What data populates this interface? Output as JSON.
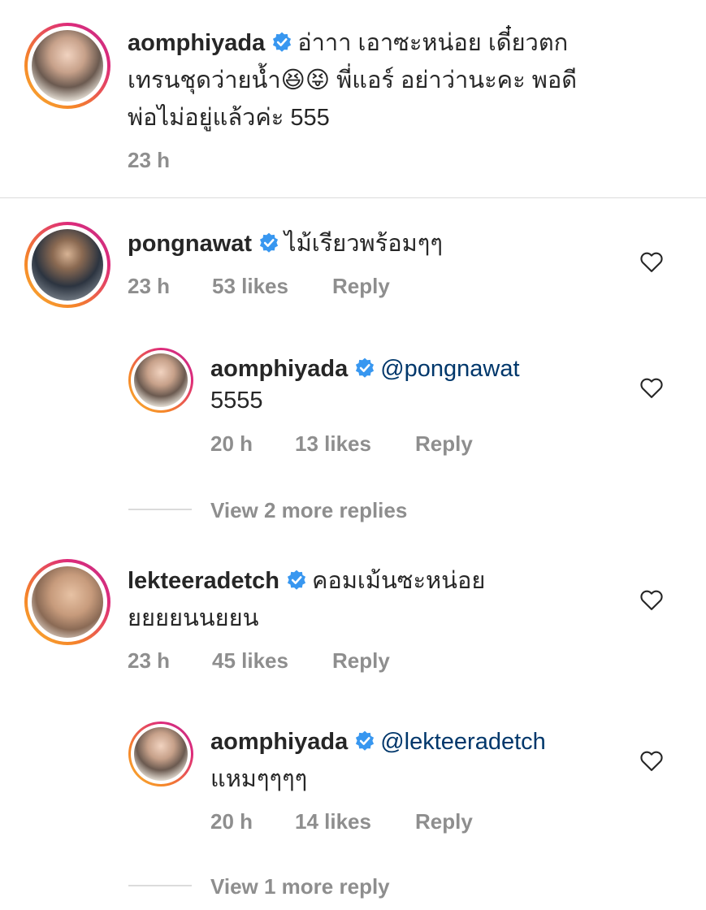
{
  "caption": {
    "username": "aomphiyada",
    "line1": "อ่าาา เอาซะหน่อย เดี๋ยวตก",
    "line2a": "เทรนชุดว่ายน้ำ",
    "line2b": "พี่แอร์ อย่าว่านะคะ พอดี",
    "line3": "พ่อไม่อยู่แล้วค่ะ 555",
    "time": "23 h"
  },
  "comments": [
    {
      "username": "pongnawat",
      "text": "ไม้เรียวพร้อมๆๆ",
      "time": "23 h",
      "likes": "53 likes",
      "reply": "Reply",
      "replies": [
        {
          "username": "aomphiyada",
          "mention": "@pongnawat",
          "text": "5555",
          "time": "20 h",
          "likes": "13 likes",
          "reply": "Reply"
        }
      ],
      "view_more": "View 2 more replies"
    },
    {
      "username": "lekteeradetch",
      "text_line1": "คอมเม้นซะหน่อย",
      "text_line2": "ยยยยนนยยน",
      "time": "23 h",
      "likes": "45 likes",
      "reply": "Reply",
      "replies": [
        {
          "username": "aomphiyada",
          "mention": "@lekteeradetch",
          "text": "แหมๆๆๆๆ",
          "time": "20 h",
          "likes": "14 likes",
          "reply": "Reply"
        }
      ],
      "view_more": "View 1 more reply"
    }
  ],
  "icons": {
    "verified": "verified-badge-icon",
    "like": "heart-outline-icon",
    "emoji1": "😆",
    "emoji2": "😝"
  },
  "colors": {
    "verified": "#3897f0",
    "text": "#262626",
    "muted": "#8e8e8e",
    "mention": "#00376b"
  }
}
